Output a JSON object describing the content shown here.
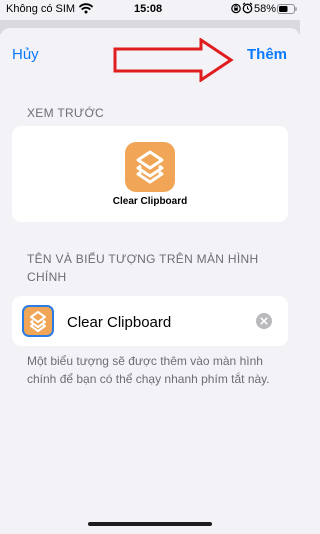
{
  "status_bar": {
    "carrier": "Không có SIM",
    "time": "15:08",
    "battery": "58%"
  },
  "nav": {
    "cancel_label": "Hủy",
    "add_label": "Thêm"
  },
  "preview": {
    "section_title": "XEM TRƯỚC",
    "shortcut_name": "Clear Clipboard"
  },
  "home_screen": {
    "section_title": "TÊN VÀ BIỂU TƯỢNG TRÊN MÀN HÌNH CHÍNH",
    "name_value": "Clear Clipboard",
    "footer_note": "Một biểu tượng sẽ được thêm vào màn hình chính để bạn có thể chạy nhanh phím tắt này."
  },
  "colors": {
    "accent": "#0a7aff",
    "icon_orange": "#f0a656",
    "annotation_red": "#e01e1e"
  },
  "icons": [
    "wifi-icon",
    "lock-rotation-icon",
    "alarm-icon",
    "battery-icon",
    "layers-icon",
    "clear-icon",
    "arrow-annotation-icon"
  ]
}
